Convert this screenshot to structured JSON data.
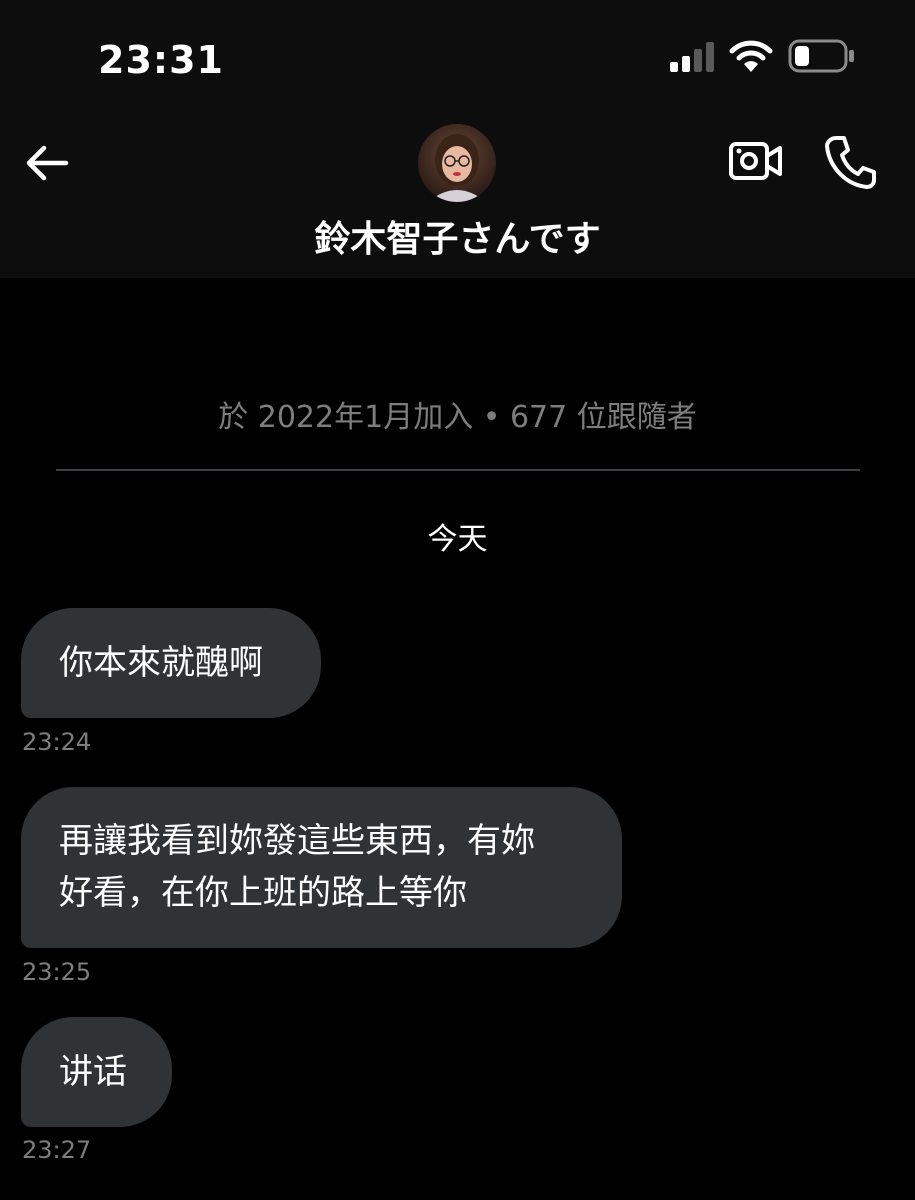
{
  "status_bar": {
    "time": "23:31"
  },
  "header": {
    "contact_name": "鈴木智子さんです"
  },
  "profile_info": {
    "join_text": "於 2022年1月加入 • 677 位跟隨者"
  },
  "day_label": "今天",
  "messages": [
    {
      "text_lines": [
        "你本來就醜啊"
      ],
      "time": "23:24"
    },
    {
      "text_lines": [
        "再讓我看到妳發這些東西，有妳",
        "好看，在你上班的路上等你"
      ],
      "time": "23:25"
    },
    {
      "text_lines": [
        "讲话"
      ],
      "time": "23:27"
    }
  ],
  "colors": {
    "background": "#000000",
    "header_background": "#0d0d0d",
    "bubble": "#2f3336",
    "secondary_text": "#7d7d7d",
    "divider": "#3b3f43"
  },
  "icons": {
    "back": "arrow-left-icon",
    "video": "video-camera-icon",
    "call": "phone-icon",
    "signal": "cellular-signal-icon",
    "wifi": "wifi-icon",
    "battery": "battery-icon"
  }
}
